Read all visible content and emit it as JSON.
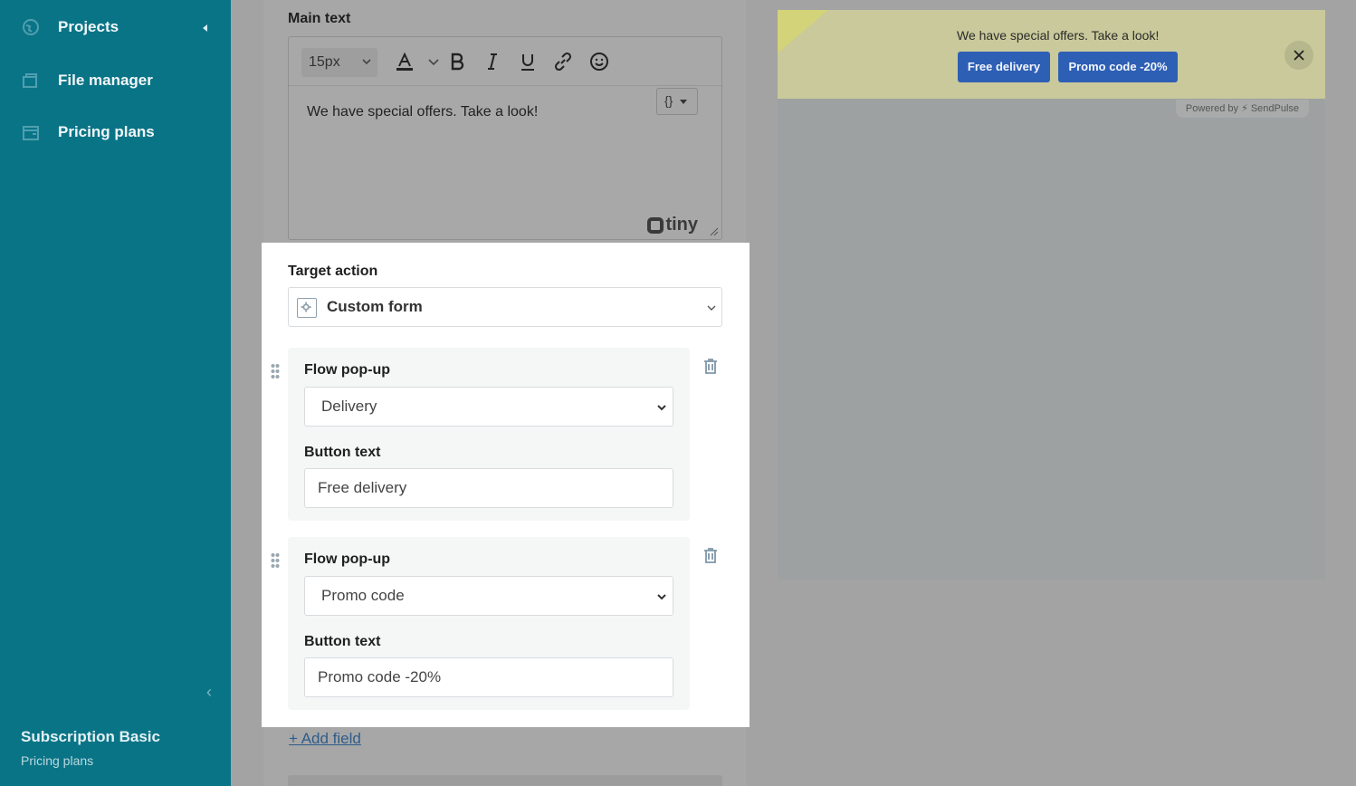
{
  "sidebar": {
    "items": [
      {
        "label": "Projects",
        "icon": "globe-icon"
      },
      {
        "label": "File manager",
        "icon": "folders-icon"
      },
      {
        "label": "Pricing plans",
        "icon": "wallet-icon"
      }
    ],
    "plan_name": "Subscription Basic",
    "plan_link": "Pricing plans",
    "collapse_glyph": "‹"
  },
  "editor": {
    "main_text_label": "Main text",
    "font_size": "15px",
    "body_text": "We have special offers. Take a look!",
    "var_button": "{}",
    "tiny_brand": "tiny"
  },
  "target": {
    "label": "Target action",
    "value": "Custom form"
  },
  "fields": [
    {
      "select_label": "Flow pop-up",
      "select_value": "Delivery",
      "button_label": "Button text",
      "button_value": "Free delivery"
    },
    {
      "select_label": "Flow pop-up",
      "select_value": "Promo code",
      "button_label": "Button text",
      "button_value": "Promo code -20%"
    }
  ],
  "add_field": "+ Add field",
  "preview": {
    "text": "We have special offers. Take a look!",
    "button1": "Free delivery",
    "button2": "Promo code -20%",
    "powered": "Powered by ⚡ SendPulse"
  },
  "colors": {
    "sidebar": "#0a7487",
    "primary_button": "#2d5fb5",
    "banner": "#c9c99b"
  }
}
